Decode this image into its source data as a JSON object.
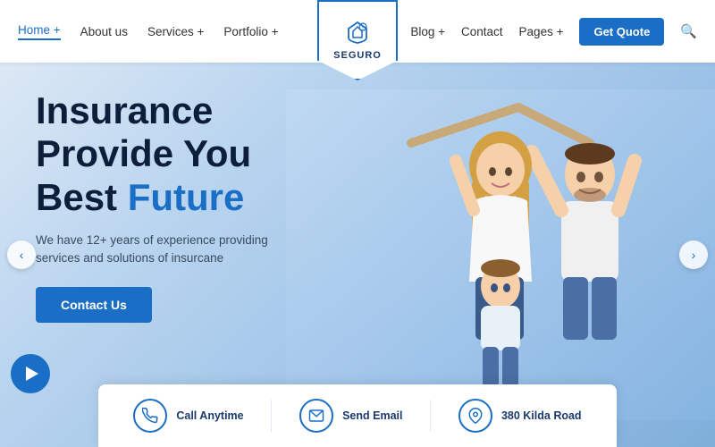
{
  "navbar": {
    "logo_text": "SEGURO",
    "nav_left": [
      {
        "label": "Home +",
        "active": true
      },
      {
        "label": "About us",
        "active": false
      },
      {
        "label": "Services +",
        "active": false
      },
      {
        "label": "Portfolio +",
        "active": false
      }
    ],
    "nav_right": [
      {
        "label": "Blog +"
      },
      {
        "label": "Contact"
      },
      {
        "label": "Pages +"
      }
    ],
    "quote_button": "Get Quote"
  },
  "hero": {
    "title_line1": "Insurance",
    "title_line2": "Provide You",
    "title_line3_plain": "Best ",
    "title_line3_highlight": "Future",
    "subtitle": "We have 12+ years of experience providing services and solutions of insurcane",
    "cta_button": "Contact Us",
    "arrow_left": "‹",
    "arrow_right": "›"
  },
  "bottom_bar": {
    "items": [
      {
        "icon": "📞",
        "label": "Call Anytime"
      },
      {
        "icon": "✉",
        "label": "Send Email"
      },
      {
        "icon": "📍",
        "label": "380 Kilda Road"
      }
    ]
  }
}
